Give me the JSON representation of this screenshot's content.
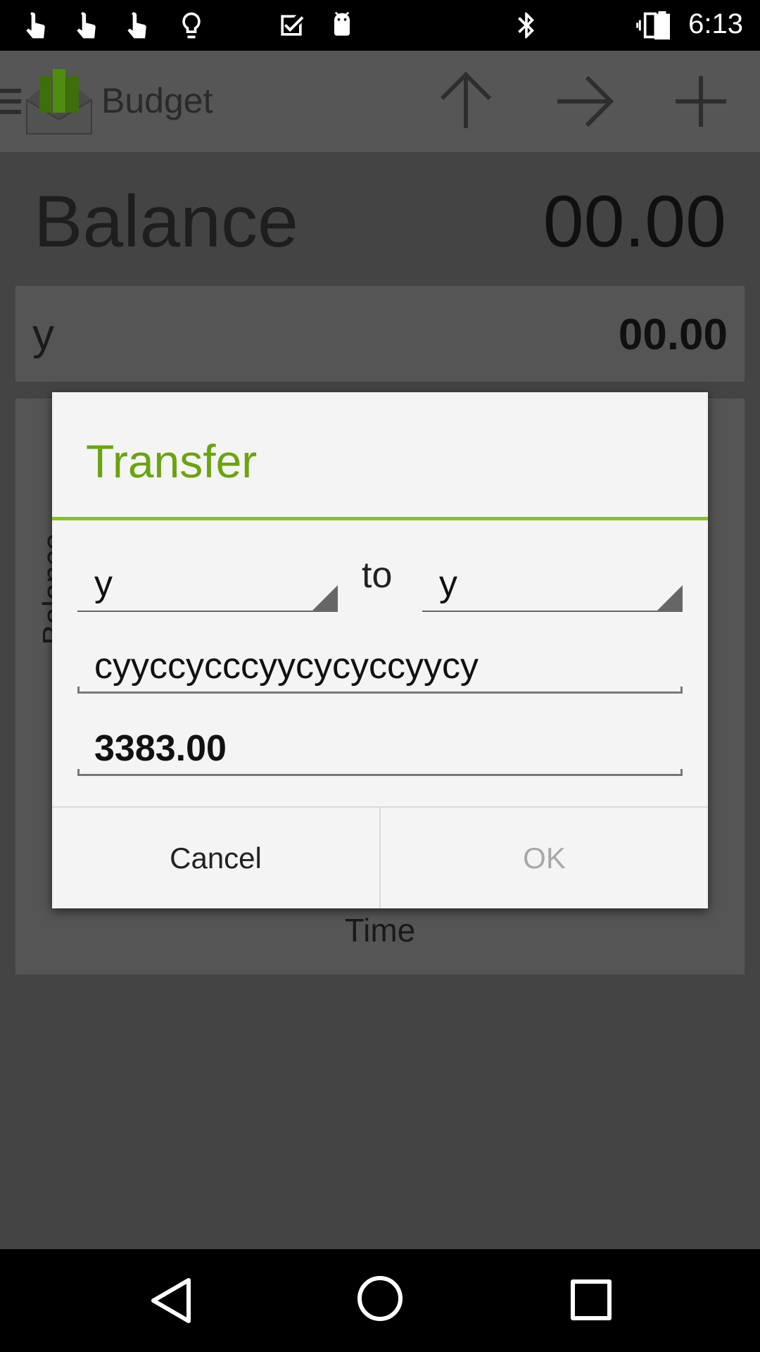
{
  "status_bar": {
    "time": "6:13",
    "icons": [
      "hand-pointer-icon",
      "hand-pointer-icon",
      "hand-pointer-icon",
      "lightbulb-icon",
      "check-box-icon",
      "android-icon",
      "bluetooth-icon",
      "vibrate-icon",
      "battery-icon"
    ]
  },
  "action_bar": {
    "title": "Budget",
    "icons": [
      "menu-icon",
      "app-logo",
      "arrow-up-icon",
      "arrow-right-icon",
      "plus-icon"
    ]
  },
  "main": {
    "balance_label": "Balance",
    "balance_value": "00.00",
    "account": {
      "name": "y",
      "value": "00.00"
    },
    "chart": {
      "ylabel": "Balance",
      "xlabel": "Time"
    }
  },
  "dialog": {
    "title": "Transfer",
    "from_account": "y",
    "to_label": "to",
    "to_account": "y",
    "description": "cyyccycccyycycyccyycy",
    "amount": "3383.00",
    "cancel_label": "Cancel",
    "ok_label": "OK"
  },
  "colors": {
    "accent": "#86c41c",
    "title": "#6aa40e",
    "dialog_bg": "#f4f4f4",
    "scrim_bg": "#434343"
  }
}
